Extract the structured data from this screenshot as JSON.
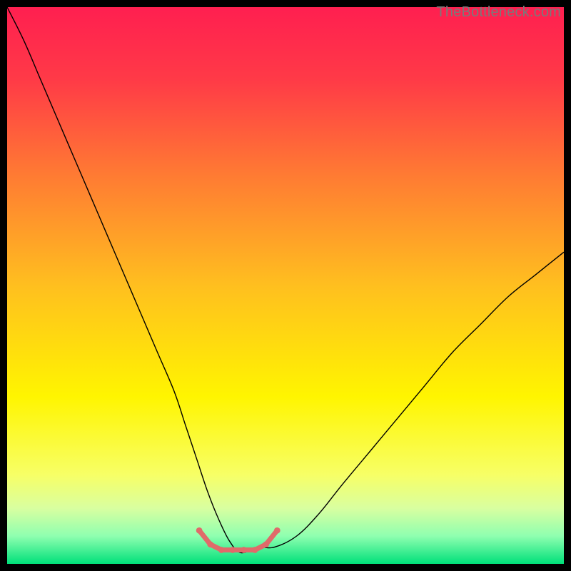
{
  "watermark": "TheBottleneck.com",
  "chart_data": {
    "type": "line",
    "title": "",
    "xlabel": "",
    "ylabel": "",
    "xlim": [
      0,
      100
    ],
    "ylim": [
      0,
      100
    ],
    "grid": false,
    "legend": false,
    "background": {
      "stops": [
        {
          "pct": 0.0,
          "color": "#ff1f50"
        },
        {
          "pct": 0.13,
          "color": "#ff3a47"
        },
        {
          "pct": 0.3,
          "color": "#ff7a33"
        },
        {
          "pct": 0.5,
          "color": "#ffbf1f"
        },
        {
          "pct": 0.7,
          "color": "#fff500"
        },
        {
          "pct": 0.84,
          "color": "#f7ff66"
        },
        {
          "pct": 0.9,
          "color": "#d9ffa0"
        },
        {
          "pct": 0.95,
          "color": "#8fffb0"
        },
        {
          "pct": 1.0,
          "color": "#00e07a"
        }
      ]
    },
    "series": [
      {
        "name": "bottleneck-curve",
        "stroke": "#000000",
        "stroke_width": 1.4,
        "x": [
          0,
          3,
          6,
          9,
          12,
          15,
          18,
          21,
          24,
          27,
          30,
          32,
          34,
          36,
          38,
          40,
          42,
          45,
          48,
          52,
          56,
          60,
          65,
          70,
          75,
          80,
          85,
          90,
          95,
          100
        ],
        "y": [
          100,
          94,
          87,
          80,
          73,
          66,
          59,
          52,
          45,
          38,
          31,
          25,
          19,
          13,
          8,
          4,
          2,
          3,
          3,
          5,
          9,
          14,
          20,
          26,
          32,
          38,
          43,
          48,
          52,
          56
        ]
      }
    ],
    "highlight": {
      "name": "optimal-range",
      "stroke": "#e06a6a",
      "stroke_width": 7,
      "points_x": [
        34.5,
        36.5,
        38.5,
        40.5,
        42.5,
        44.5,
        46.5,
        48.5
      ],
      "points_y": [
        6.0,
        3.5,
        2.5,
        2.5,
        2.5,
        2.5,
        3.5,
        6.0
      ]
    }
  }
}
